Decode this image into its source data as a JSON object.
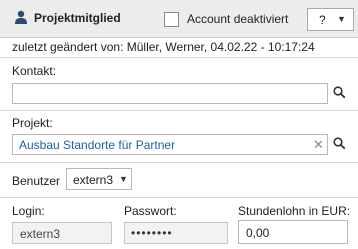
{
  "header": {
    "title": "Projektmitglied",
    "deactivated_label": "Account deaktiviert",
    "help_label": "?"
  },
  "meta": {
    "last_changed": "zuletzt geändert von: Müller, Werner, 04.02.22 - 10:17:24"
  },
  "kontakt": {
    "label": "Kontakt:",
    "value": ""
  },
  "projekt": {
    "label": "Projekt:",
    "value": "Ausbau Standorte für Partner"
  },
  "benutzer": {
    "label": "Benutzer",
    "value": "extern3"
  },
  "login": {
    "label": "Login:",
    "value": "extern3"
  },
  "passwort": {
    "label": "Passwort:",
    "value": "••••••••"
  },
  "stundenlohn": {
    "label": "Stundenlohn in EUR:",
    "value": "0,00"
  },
  "colors": {
    "link": "#1f5fa8",
    "person_icon": "#2e4a6e"
  }
}
